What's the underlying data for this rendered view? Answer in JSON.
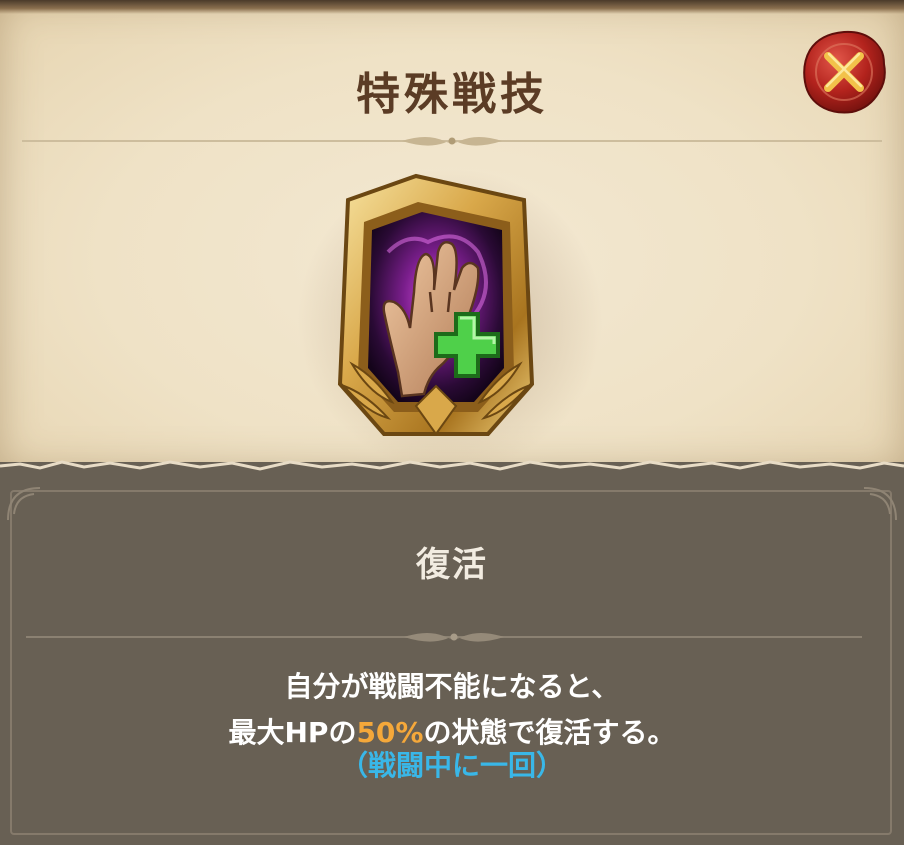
{
  "header": {
    "title": "特殊戦技"
  },
  "close_button": {
    "icon": "close-icon",
    "color": "#c8322a"
  },
  "skill": {
    "icon": "reviving-hand-icon",
    "name": "復活",
    "description_line1": "自分が戦闘不能になると、",
    "description_line2_prefix": "最大HPの",
    "description_line2_highlight": "50%",
    "description_line2_suffix": "の状態で復活する。",
    "note": "（戦闘中に一回）"
  },
  "colors": {
    "title": "#5b3c25",
    "highlight": "#f5a83a",
    "note": "#39b7e8",
    "panel": "#686054"
  }
}
